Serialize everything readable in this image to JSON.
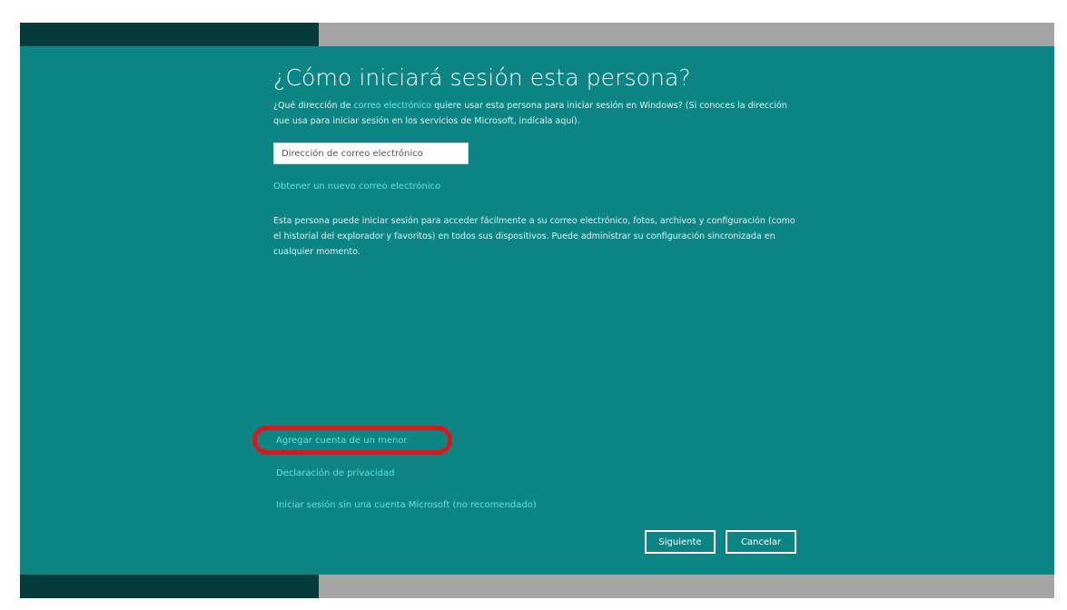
{
  "dialog": {
    "title": "¿Cómo iniciará sesión esta persona?",
    "intro_prefix": "¿Qué dirección de ",
    "intro_link": "correo electrónico",
    "intro_suffix": " quiere usar esta persona para iniciar sesión en Windows? (Si conoces la dirección que usa para iniciar sesión en los servicios de Microsoft, indícala aquí).",
    "email_placeholder": "Dirección de correo electrónico",
    "get_new_email": "Obtener un nuevo correo electrónico",
    "description": "Esta persona puede iniciar sesión para acceder fácilmente a su correo electrónico, fotos, archivos y configuración (como el historial del explorador y favoritos) en todos sus dispositivos. Puede administrar su configuración sincronizada en cualquier momento.",
    "add_child_account": "Agregar cuenta de un menor",
    "privacy_statement": "Declaración de privacidad",
    "sign_in_without_ms": "Iniciar sesión sin una cuenta Microsoft (no recomendado)",
    "next_button": "Siguiente",
    "cancel_button": "Cancelar"
  },
  "colors": {
    "background": "#0e8585",
    "dark_bar": "#063b3b",
    "gray_bar": "#a5a5a5",
    "link": "#5fe0e0",
    "highlight": "#e0151b"
  }
}
